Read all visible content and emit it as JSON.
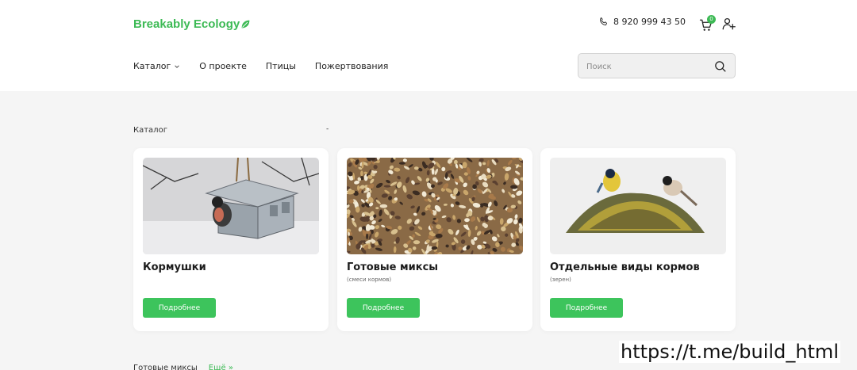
{
  "brand": {
    "name": "Breakably Ecology",
    "color": "#3dba55",
    "icon": "leaf-icon"
  },
  "header": {
    "phone": "8 920 999 43 50",
    "cart_count": "0"
  },
  "nav": {
    "items": [
      {
        "label": "Каталог",
        "has_dropdown": true
      },
      {
        "label": "О проекте"
      },
      {
        "label": "Птицы"
      },
      {
        "label": "Пожертвования"
      }
    ]
  },
  "search": {
    "placeholder": "Поиск",
    "value": ""
  },
  "catalog": {
    "title": "Каталог",
    "dash": "-",
    "cards": [
      {
        "title": "Кормушки",
        "subtitle": "",
        "button": "Подробнее",
        "image": "bird-feeder-image"
      },
      {
        "title": "Готовые миксы",
        "subtitle": "(смеси кормов)",
        "button": "Подробнее",
        "image": "seed-mix-image"
      },
      {
        "title": "Отдельные виды кормов",
        "subtitle": "(зерен)",
        "button": "Подробнее",
        "image": "birds-on-seeds-image"
      }
    ]
  },
  "bottom": {
    "label": "Готовые миксы",
    "more": "Ещё »"
  },
  "watermark": "https://t.me/build_html",
  "colors": {
    "accent": "#3dba55",
    "button": "#3dc45c",
    "page_bg": "#f5f5f5"
  }
}
